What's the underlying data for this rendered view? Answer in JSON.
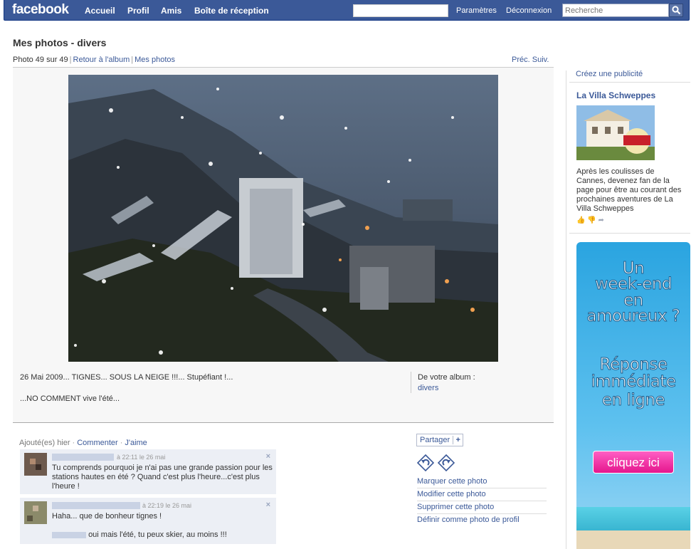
{
  "topbar": {
    "logo": "facebook",
    "nav": [
      "Accueil",
      "Profil",
      "Amis",
      "Boîte de réception"
    ],
    "settings": "Paramètres",
    "logout": "Déconnexion",
    "search_placeholder": "Recherche"
  },
  "page": {
    "title": "Mes photos - divers",
    "photo_counter": "Photo 49 sur 49",
    "back_to_album": "Retour à l'album",
    "my_photos": "Mes photos",
    "prev": "Préc.",
    "next": "Suiv."
  },
  "photo": {
    "caption_line1": "26 Mai 2009... TIGNES... SOUS LA NEIGE !!!... Stupéfiant !...",
    "caption_line2": "...NO COMMENT vive l'été...",
    "album_label": "De votre album :",
    "album_name": "divers"
  },
  "comments_header": {
    "added": "Ajouté(es) hier",
    "comment_link": "Commenter",
    "like_link": "J'aime"
  },
  "comments": [
    {
      "time": "à 22:11 le 26 mai",
      "text_lines": [
        "Tu comprends pourquoi je n'ai pas une grande passion pour les",
        "stations hautes en été ? Quand c'est plus l'heure...c'est plus",
        "l'heure !"
      ],
      "close": "×"
    },
    {
      "time": "à 22:19 le 26 mai",
      "text_lines": [
        "Haha... que de bonheur tignes !",
        "oui mais l'été, tu peux skier, au moins !!!"
      ],
      "close": "×"
    }
  ],
  "actions": {
    "share": "Partager",
    "share_plus": "+",
    "items": [
      "Marquer cette photo",
      "Modifier cette photo",
      "Supprimer cette photo",
      "Définir comme photo de profil"
    ]
  },
  "sidebar": {
    "create_ad": "Créez une publicité",
    "ad_title": "La Villa Schweppes",
    "ad_text": "Après les coulisses de Cannes, devenez fan de la page pour être au courant des prochaines aventures de La Villa Schweppes",
    "banner": {
      "lines_top": [
        "Un",
        "week-end",
        "en",
        "amoureux ?"
      ],
      "lines_mid": [
        "Réponse",
        "immédiate",
        "en ligne"
      ],
      "button": "cliquez ici"
    }
  },
  "colors": {
    "brand_blue": "#3b5998",
    "link_blue": "#3b5998",
    "comment_bg": "#eceff5",
    "banner_pink": "#e5168d"
  }
}
